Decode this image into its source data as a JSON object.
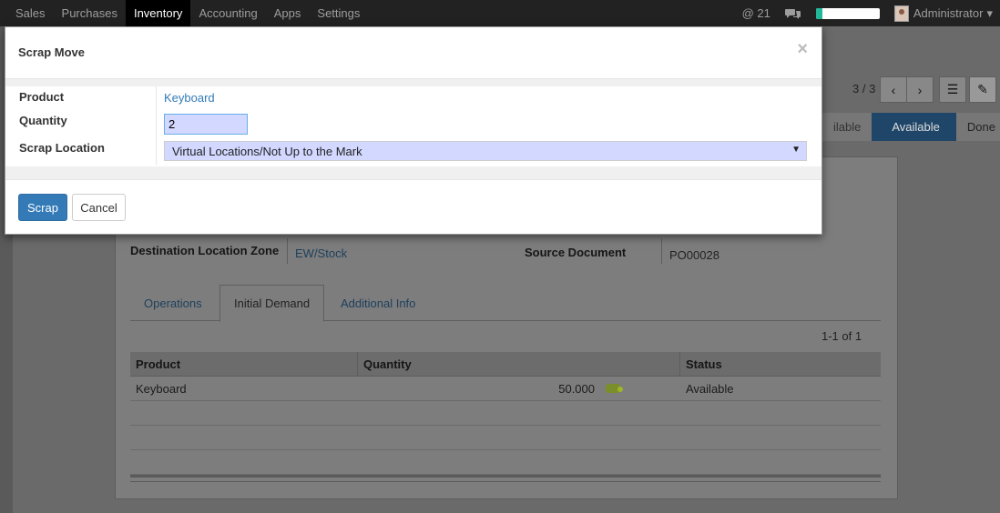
{
  "topbar": {
    "menu": [
      "Sales",
      "Purchases",
      "Inventory",
      "Accounting",
      "Apps",
      "Settings"
    ],
    "active_index": 2,
    "mentions": "@ 21",
    "chat_icon": "chat-bubbles-icon",
    "progress_fraction": 0.1,
    "user": "Administrator",
    "user_caret": "▾"
  },
  "background": {
    "pager": "3 / 3",
    "prev_glyph": "‹",
    "next_glyph": "›",
    "list_glyph": "☰",
    "form_glyph": "✎",
    "status_steps": [
      "ilable",
      "Available",
      "Done"
    ],
    "fields": {
      "dest_zone_label": "Destination Location Zone",
      "dest_zone_value": "EW/Stock",
      "source_doc_label": "Source Document",
      "source_doc_value": "PO00028"
    },
    "tabs": [
      "Operations",
      "Initial Demand",
      "Additional Info"
    ],
    "active_tab": 1,
    "record_count": "1-1 of 1",
    "table": {
      "headers": [
        "Product",
        "Quantity",
        "Status"
      ],
      "rows": [
        {
          "product": "Keyboard",
          "quantity": "50.000",
          "status": "Available"
        }
      ]
    }
  },
  "modal": {
    "title": "Scrap Move",
    "close": "×",
    "product_label": "Product",
    "product_value": "Keyboard",
    "quantity_label": "Quantity",
    "quantity_value": "2",
    "location_label": "Scrap Location",
    "location_value": "Virtual Locations/Not Up to the Mark",
    "select_arrow": "▼",
    "scrap_button": "Scrap",
    "cancel_button": "Cancel"
  }
}
